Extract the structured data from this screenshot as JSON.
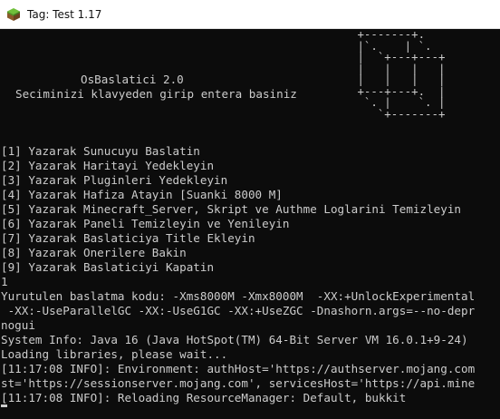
{
  "window": {
    "title": "Tag: Test 1.17",
    "icon": "minecraft-grass-block-icon"
  },
  "header": {
    "app_name": "OsBaslatici 2.0",
    "instruction": "Seciminizi klavyeden girip entera basiniz",
    "logo_art": " +-------+.\n |`.    | `.\n |  `+---+---+\n |   |   |   |\n |   |   |   |\n +---+---+.  |\n  `. |    `. |\n    `+-------+"
  },
  "menu": [
    "[1] Yazarak Sunucuyu Baslatin",
    "[2] Yazarak Haritayi Yedekleyin",
    "[3] Yazarak Pluginleri Yedekleyin",
    "[4] Yazarak Hafiza Atayin [Suanki 8000 M]",
    "[5] Yazarak Minecraft_Server, Skript ve Authme Loglarini Temizleyin",
    "[6] Yazarak Paneli Temizleyin ve Yenileyin",
    "[7] Yazarak Baslaticiya Title Ekleyin",
    "[8] Yazarak Onerilere Bakin",
    "[9] Yazarak Baslaticiyi Kapatin"
  ],
  "input": "1",
  "output": [
    "Yurutulen baslatma kodu: -Xms8000M -Xmx8000M  -XX:+UnlockExperimental",
    " -XX:-UseParallelGC -XX:-UseG1GC -XX:+UseZGC -Dnashorn.args=--no-depr",
    "nogui",
    "System Info: Java 16 (Java HotSpot(TM) 64-Bit Server VM 16.0.1+9-24)",
    "Loading libraries, please wait...",
    "[11:17:08 INFO]: Environment: authHost='https://authserver.mojang.com",
    "st='https://sessionserver.mojang.com', servicesHost='https://api.mine",
    "[11:17:08 INFO]: Reloading ResourceManager: Default, bukkit"
  ],
  "colors": {
    "console_bg": "#0c0c0c",
    "console_text": "#cccccc",
    "titlebar_bg": "#ffffff"
  }
}
